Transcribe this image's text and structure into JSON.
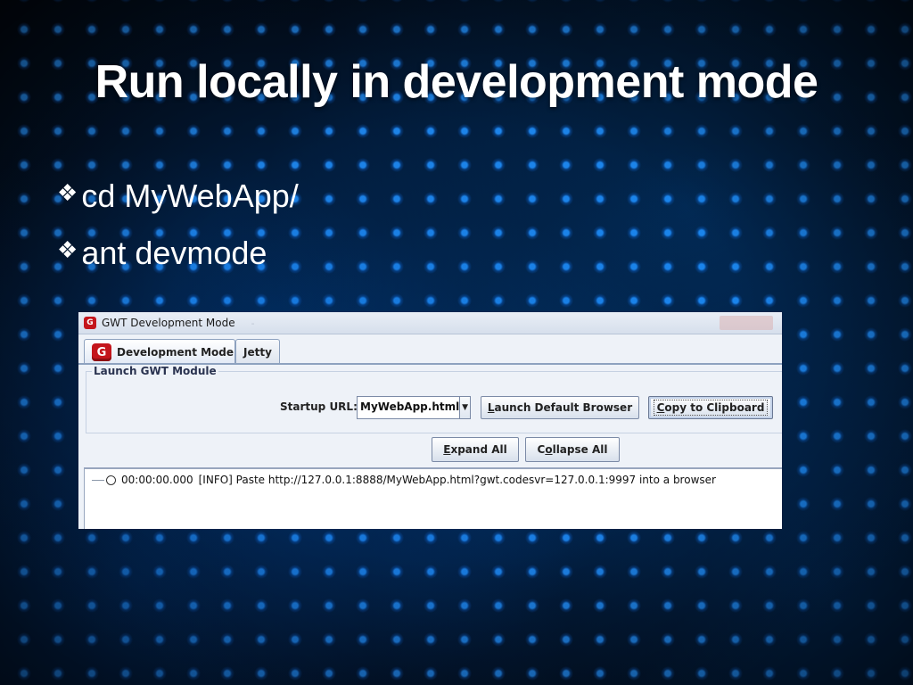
{
  "slide": {
    "title": "Run locally in development mode",
    "bullet_glyph": "❖",
    "bullets": [
      "cd MyWebApp/",
      "ant devmode"
    ]
  },
  "window": {
    "title": "GWT Development Mode",
    "tabs": [
      {
        "label": "Development Mode",
        "icon": "gwt-logo-icon",
        "active": true
      },
      {
        "label": "Jetty",
        "active": false
      }
    ],
    "group_label": "Launch GWT Module",
    "startup_url_label": "Startup URL:",
    "startup_url_value": "MyWebApp.html",
    "launch_button": {
      "accel": "L",
      "rest": "aunch Default Browser"
    },
    "copy_button": {
      "accel": "C",
      "rest": "opy to Clipboard"
    },
    "expand_button": {
      "accel": "E",
      "rest": "xpand All"
    },
    "collapse_button": {
      "before": "C",
      "accel": "o",
      "rest": "llapse All"
    },
    "log": {
      "time": "00:00:00.000",
      "message": "[INFO] Paste http://127.0.0.1:8888/MyWebApp.html?gwt.codesvr=127.0.0.1:9997 into a browser"
    }
  },
  "colors": {
    "background": "#020812",
    "dot_blue": "#2896ff",
    "gwt_red": "#c4161c",
    "window_bg": "#eef2f8"
  }
}
